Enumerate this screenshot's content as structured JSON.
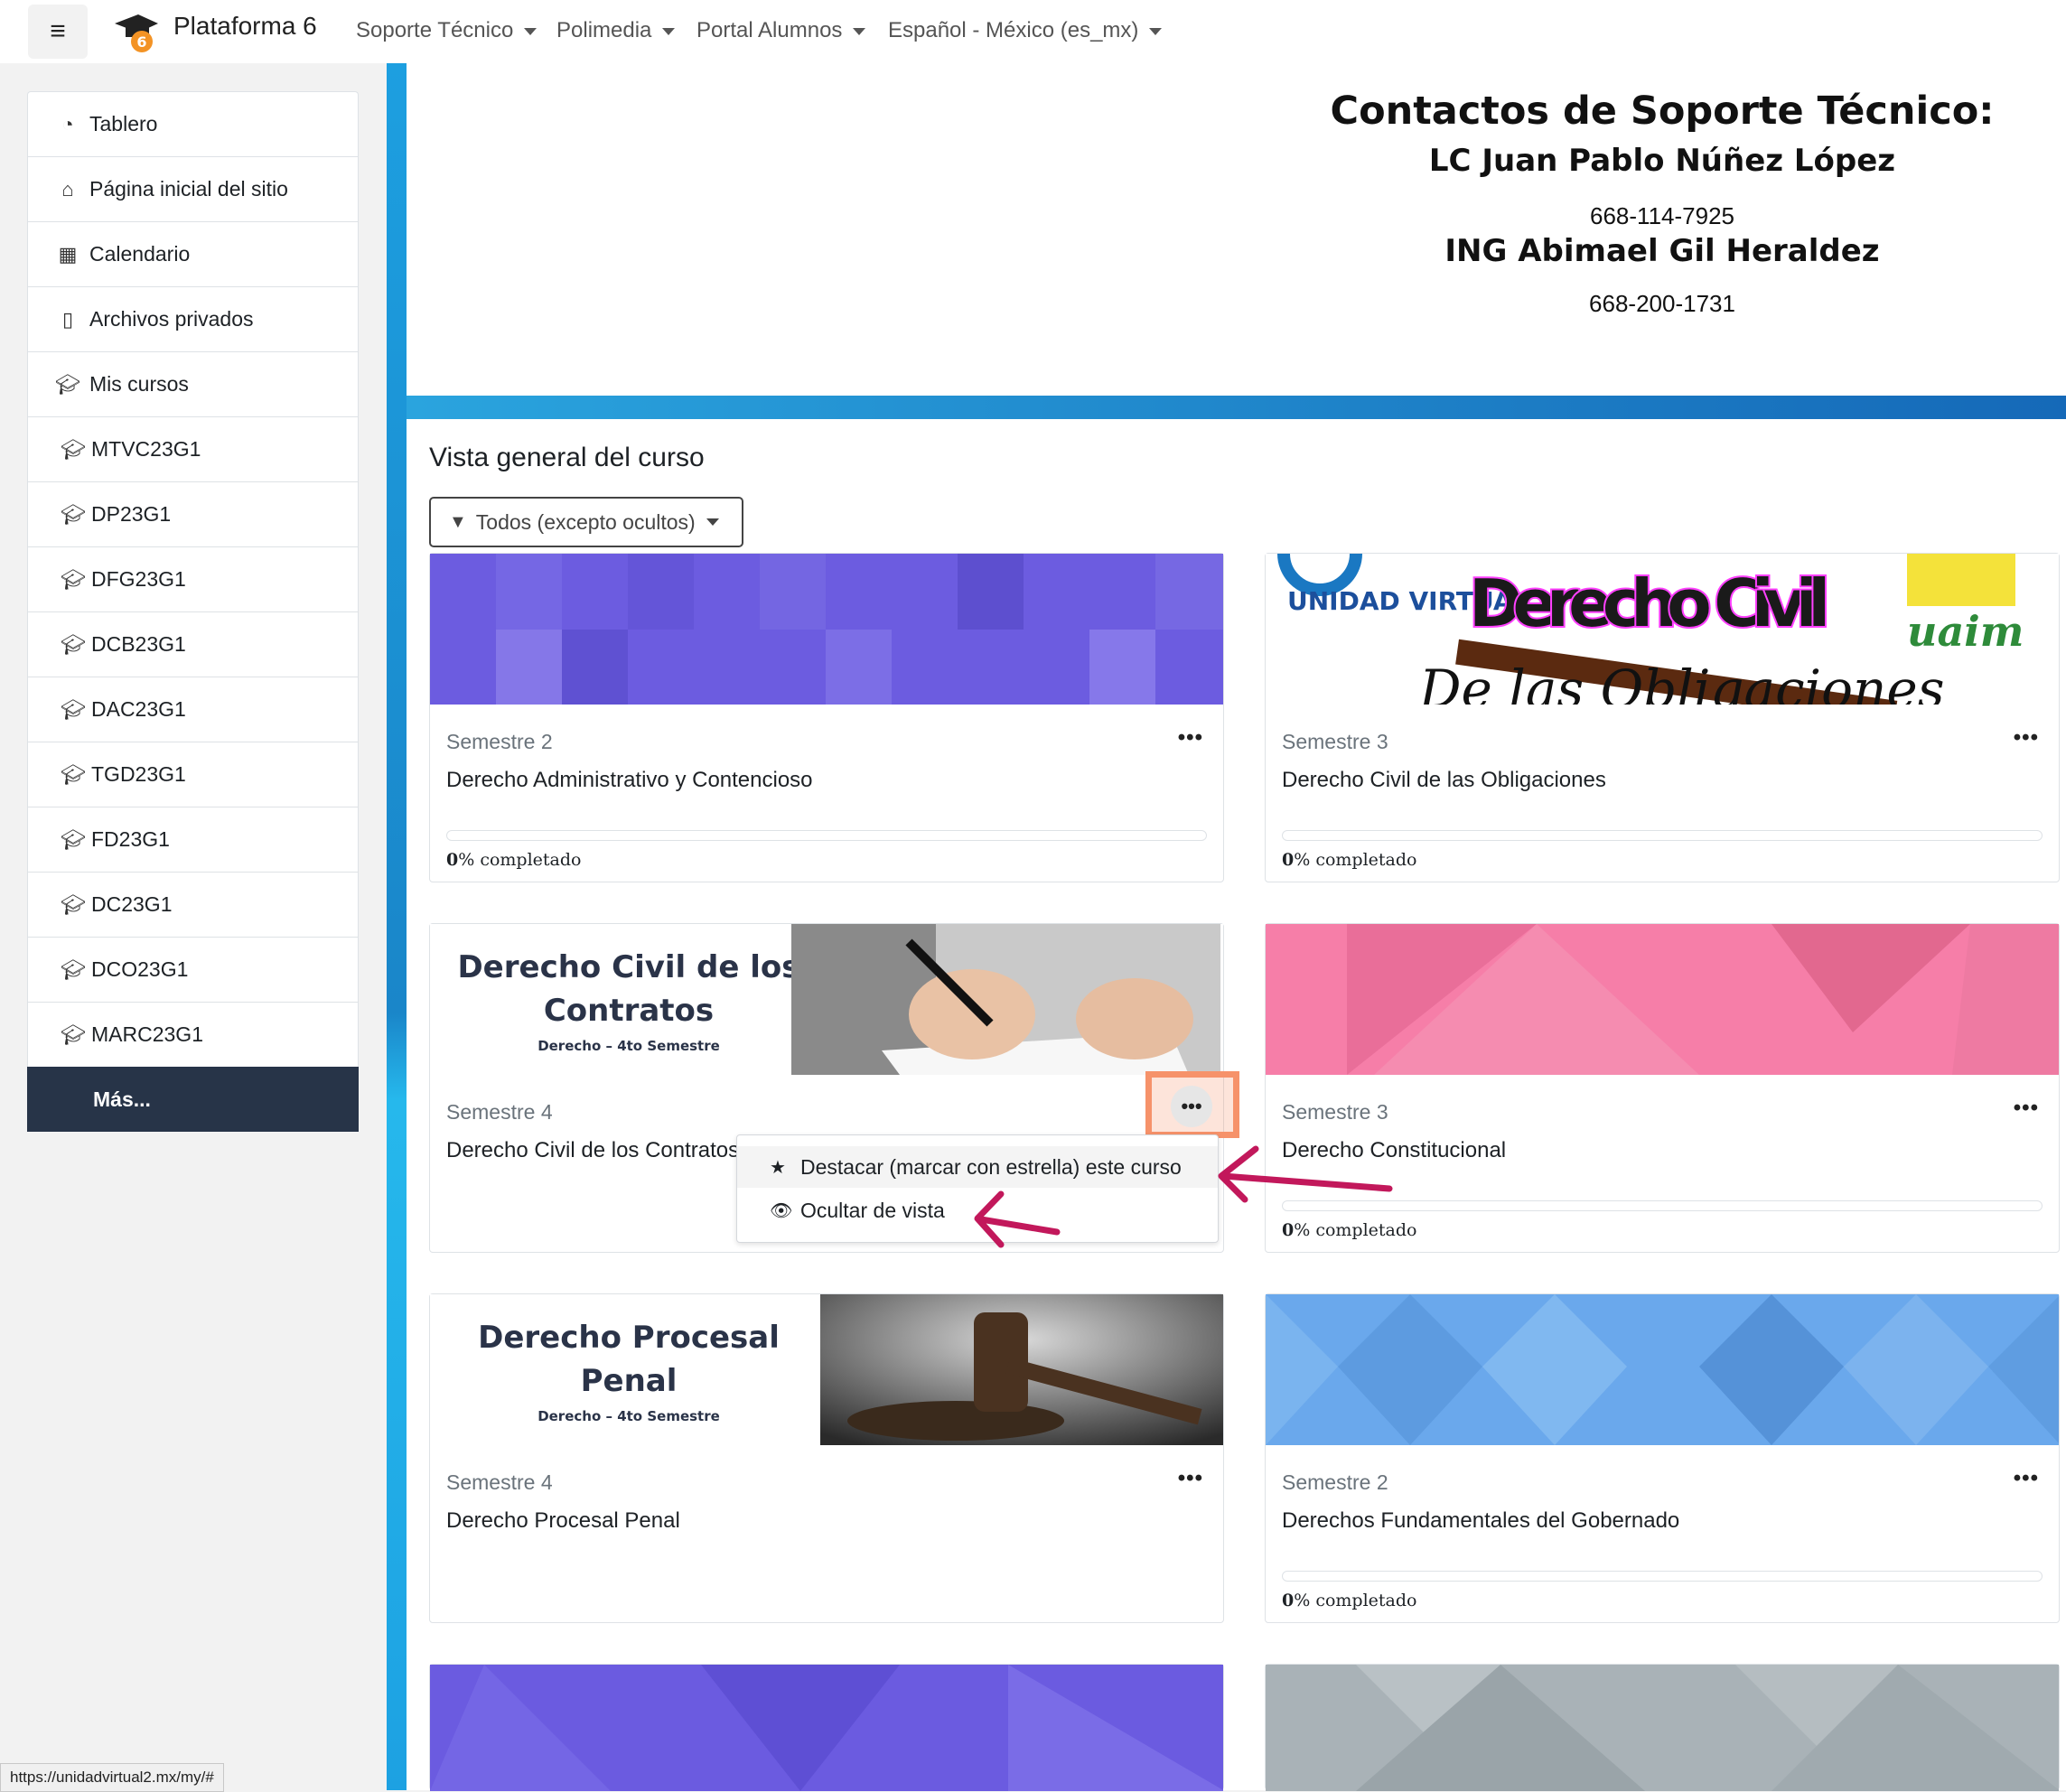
{
  "navbar": {
    "brand": "Plataforma 6",
    "menus": [
      "Soporte Técnico",
      "Polimedia",
      "Portal Alumnos",
      "Español - México (es_mx)"
    ]
  },
  "drawer": {
    "items": [
      {
        "label": "Tablero",
        "icon": "dashboard-icon"
      },
      {
        "label": "Página inicial del sitio",
        "icon": "home-icon"
      },
      {
        "label": "Calendario",
        "icon": "calendar-icon"
      },
      {
        "label": "Archivos privados",
        "icon": "file-icon"
      },
      {
        "label": "Mis cursos",
        "icon": "graduation-cap-icon"
      }
    ],
    "courses": [
      "MTVC23G1",
      "DP23G1",
      "DFG23G1",
      "DCB23G1",
      "DAC23G1",
      "TGD23G1",
      "FD23G1",
      "DC23G1",
      "DCO23G1",
      "MARC23G1"
    ],
    "more": "Más..."
  },
  "header": {
    "title": "Contactos de Soporte Técnico:",
    "contact1_name": "LC Juan Pablo Núñez López",
    "contact1_phone": "668-114-7925",
    "contact2_name": "ING Abimael Gil Heraldez",
    "contact2_phone": "668-200-1731"
  },
  "overview": {
    "title": "Vista general del curso",
    "filter": "Todos (excepto ocultos)"
  },
  "courses": [
    {
      "category": "Semestre 2",
      "name": "Derecho Administrativo y Contencioso",
      "progress": "% completado",
      "progress_value": "0"
    },
    {
      "category": "Semestre 3",
      "name": "Derecho Civil de las Obligaciones",
      "progress": "% completado",
      "progress_value": "0",
      "image_text": {
        "left": "UNIDAD VIRTUAL",
        "title": "Derecho Civil",
        "subtitle": "De las Obligaciones",
        "right": "uaim"
      }
    },
    {
      "category": "Semestre 4",
      "name": "Derecho Civil de los Contratos",
      "image_text": {
        "title": "Derecho Civil de los Contratos",
        "subtitle": "Derecho – 4to Semestre"
      }
    },
    {
      "category": "Semestre 3",
      "name": "Derecho Constitucional",
      "progress": "% completado",
      "progress_value": "0"
    },
    {
      "category": "Semestre 4",
      "name": "Derecho Procesal Penal",
      "image_text": {
        "title": "Derecho Procesal Penal",
        "subtitle": "Derecho – 4to Semestre"
      }
    },
    {
      "category": "Semestre 2",
      "name": "Derechos Fundamentales del Gobernado",
      "progress": "% completado",
      "progress_value": "0"
    }
  ],
  "dropdown": {
    "star": "Destacar (marcar con estrella) este curso",
    "hide": "Ocultar de vista"
  },
  "status_url": "https://unidadvirtual2.mx/my/#",
  "colors": {
    "accent": "#1d9fe0",
    "drawer_active": "#273448",
    "annotation": "#c2185b",
    "highlight": "#f6926a"
  }
}
